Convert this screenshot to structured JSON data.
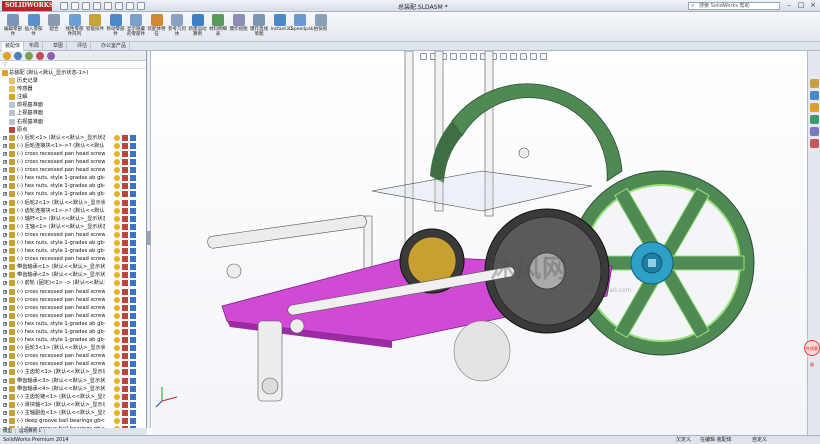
{
  "app": {
    "logo": "SOLIDWORKS",
    "window_title": "总装配.SLDASM *",
    "help_search_placeholder": "搜索 SolidWorks 帮助",
    "win_controls": [
      "–",
      "□",
      "×"
    ]
  },
  "toolbar": {
    "tools": [
      {
        "label": "编辑零部件",
        "color": "#7d95b8"
      },
      {
        "label": "插入零部件",
        "color": "#5a8fd0"
      },
      {
        "label": "配合",
        "color": "#8a9ab0"
      },
      {
        "label": "线性零部件阵列",
        "color": "#6aa0d8"
      },
      {
        "label": "智能扣件",
        "color": "#c9a23c"
      },
      {
        "label": "移动零部件",
        "color": "#4d88c8"
      },
      {
        "label": "显示隐藏的零部件",
        "color": "#7aa0cc"
      },
      {
        "label": "装配体特征",
        "color": "#d08a30"
      },
      {
        "label": "参考几何体",
        "color": "#8aa2c0"
      },
      {
        "label": "新建运动算例",
        "color": "#3f7fc8"
      },
      {
        "label": "材料明细表",
        "color": "#5a9a5a"
      },
      {
        "label": "爆炸视图",
        "color": "#8a8fb8"
      },
      {
        "label": "爆炸直线草图",
        "color": "#7a96b0"
      },
      {
        "label": "Instant3D",
        "color": "#4a88c8"
      },
      {
        "label": "Speedpak",
        "color": "#6a9ad0"
      },
      {
        "label": "拍快照",
        "color": "#8aa0b8"
      }
    ]
  },
  "tabs": [
    "装配体",
    "布局",
    "草图",
    "评估",
    "办公室产品"
  ],
  "active_tab": "装配体",
  "tree": {
    "filter": "▽",
    "root": "总装配 (默认<默认_显示状态-1>)",
    "items": [
      {
        "label": "历史记录",
        "kind": "folder"
      },
      {
        "label": "传感器",
        "kind": "folder"
      },
      {
        "label": "注解",
        "kind": "note"
      },
      {
        "label": "前视基准面",
        "kind": "plane"
      },
      {
        "label": "上视基准面",
        "kind": "plane"
      },
      {
        "label": "右视基准面",
        "kind": "plane"
      },
      {
        "label": "原点",
        "kind": "origin"
      },
      {
        "label": "(-) 后轮<1> (默认<<默认>_显示状态",
        "kind": "part"
      },
      {
        "label": "(-) 后轮连接块<1>->? (默认<<默认>_",
        "kind": "part"
      },
      {
        "label": "(-) cross recessed pan head screw",
        "kind": "part"
      },
      {
        "label": "(-) cross recessed pan head screw",
        "kind": "part"
      },
      {
        "label": "(-) cross recessed pan head screw",
        "kind": "part"
      },
      {
        "label": "(-) hex nuts, style 1-grades ab gb<",
        "kind": "part"
      },
      {
        "label": "(-) hex nuts, style 1-grades ab gb<",
        "kind": "part"
      },
      {
        "label": "(-) hex nuts, style 1-grades ab gb<",
        "kind": "part"
      },
      {
        "label": "(-) 后轮2<1> (默认<<默认>_显示状态",
        "kind": "part"
      },
      {
        "label": "(-) 齿轮连接块<1>->? (默认<<默认>",
        "kind": "part"
      },
      {
        "label": "(-) 轴杆<1> (默认<<默认>_显示状态",
        "kind": "part"
      },
      {
        "label": "(-) 主轴<1> (默认<<默认>_显示状态",
        "kind": "part"
      },
      {
        "label": "(-) cross recessed pan head screw",
        "kind": "part"
      },
      {
        "label": "(-) hex nuts, style 1-grades ab gb<",
        "kind": "part"
      },
      {
        "label": "(-) hex nuts, style 1-grades ab gb<",
        "kind": "part"
      },
      {
        "label": "(-) cross recessed pan head screw",
        "kind": "part"
      },
      {
        "label": "带齿轴承<1> (默认<<默认>_显示状",
        "kind": "part"
      },
      {
        "label": "带齿轴承<2> (默认<<默认>_显示状",
        "kind": "part"
      },
      {
        "label": "(-) 前轮 (固定)<1> -> (默认<<默认>",
        "kind": "part"
      },
      {
        "label": "(-) cross recessed pan head screw",
        "kind": "part"
      },
      {
        "label": "(-) cross recessed pan head screw",
        "kind": "part"
      },
      {
        "label": "(-) cross recessed pan head screw",
        "kind": "part"
      },
      {
        "label": "(-) cross recessed pan head screw",
        "kind": "part"
      },
      {
        "label": "(-) hex nuts, style 1-grades ab gb<",
        "kind": "part"
      },
      {
        "label": "(-) hex nuts, style 1-grades ab gb<",
        "kind": "part"
      },
      {
        "label": "(-) hex nuts, style 1-grades ab gb<",
        "kind": "part"
      },
      {
        "label": "(-) 后轮3<1> (默认<<默认>_显示状",
        "kind": "part"
      },
      {
        "label": "(-) cross recessed pan head screw",
        "kind": "part"
      },
      {
        "label": "(-) cross recessed pan head screw",
        "kind": "part"
      },
      {
        "label": "(-) 主齿轮<1> (默认<<默认>_显示状",
        "kind": "part"
      },
      {
        "label": "带齿轴承<3> (默认<<默认>_显示状",
        "kind": "part"
      },
      {
        "label": "带齿轴承<4> (默认<<默认>_显示状",
        "kind": "part"
      },
      {
        "label": "(-) 主齿轮链<1> (默认<<默认>_显示",
        "kind": "part"
      },
      {
        "label": "(-) 滑块轴<1> (默认<<默认>_显示状",
        "kind": "part"
      },
      {
        "label": "(-) 主轴副齿<1> (默认<<默认>_显示",
        "kind": "part"
      },
      {
        "label": "(-) deep groove ball bearings gb<",
        "kind": "part"
      },
      {
        "label": "(-) deep groove ball bearings gb<",
        "kind": "part"
      },
      {
        "label": "(-) 变角齿<1> (默认<<默认>_显示状",
        "kind": "part"
      }
    ]
  },
  "bottom_tabs": [
    "模型",
    "运动算例 1"
  ],
  "viewport": {
    "watermark": "沐风网",
    "watermark_sub": "www.mfcad.com",
    "badge": "在线客服"
  },
  "status": {
    "app_version": "SolidWorks Premium 2014",
    "defined": "欠定义",
    "editing": "在编辑 装配体",
    "units": "自定义"
  },
  "colors": {
    "plate": "#d04ad6",
    "wheel": "#4f8a55",
    "wheel_edge": "#9ae07a",
    "hub": "#2ea0c8",
    "gear": "#3a3a3a",
    "metal": "#e6e6e6"
  }
}
